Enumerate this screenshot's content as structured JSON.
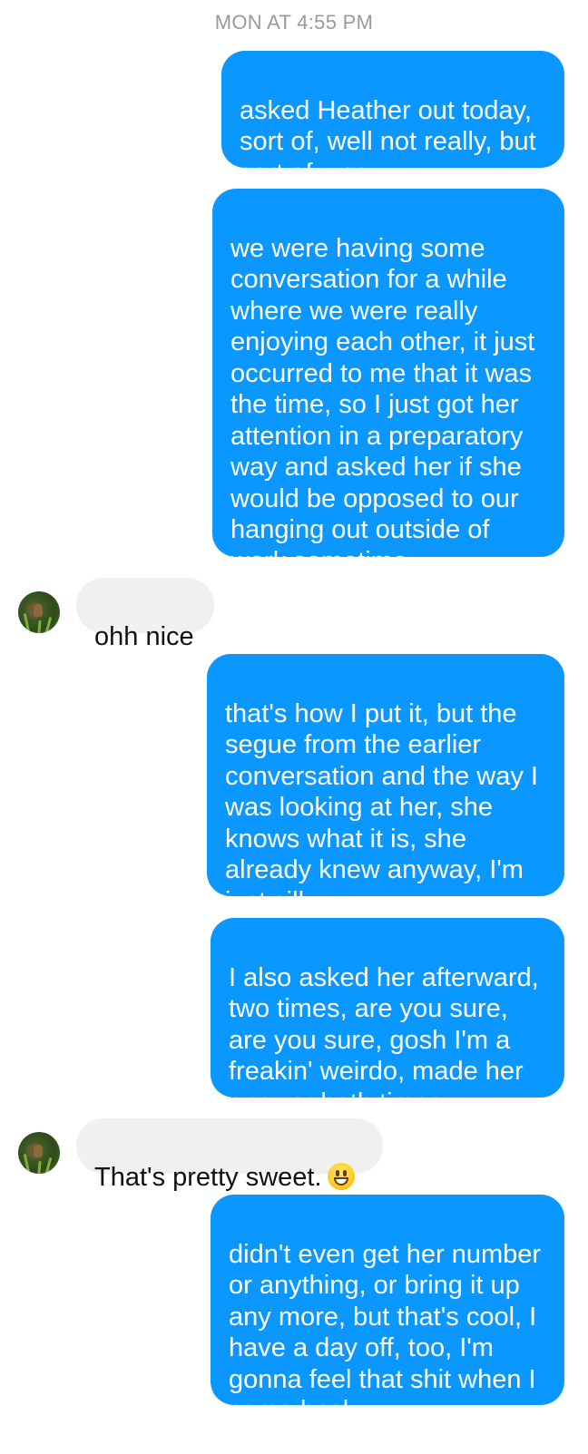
{
  "timestamp": "MON AT 4:55 PM",
  "messages": [
    {
      "sender": "me",
      "text": "asked Heather out today, sort of, well not really, but sort of, yes"
    },
    {
      "sender": "me",
      "text": "we were having some conversation for a while where we were really enjoying each other, it just occurred to me that it was the time, so I just got her attention in a preparatory way and asked her if she would be opposed to our hanging out outside of work sometime"
    },
    {
      "sender": "them",
      "text": "ohh nice"
    },
    {
      "sender": "me",
      "text": "that's how I put it, but the segue from the earlier conversation and the way I was looking at her, she knows what it is, she already knew anyway, I'm just silly"
    },
    {
      "sender": "me",
      "text": "I also asked her afterward, two times, are you sure, are you sure, gosh I'm a freakin' weirdo, made her answer both times"
    },
    {
      "sender": "them",
      "text": "That's pretty sweet.",
      "emoji": "grinning-face-emoji"
    },
    {
      "sender": "me",
      "text": "didn't even get her number or anything, or bring it up any more, but that's cool, I have a day off, too, I'm gonna feel that shit when I come back"
    }
  ]
}
